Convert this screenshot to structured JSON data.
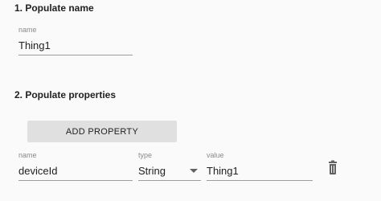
{
  "sections": {
    "name_title": "1. Populate name",
    "properties_title": "2. Populate properties"
  },
  "name_field": {
    "label": "name",
    "value": "Thing1"
  },
  "add_property": {
    "label": "ADD PROPERTY"
  },
  "property_row": {
    "name_label": "name",
    "name_value": "deviceId",
    "type_label": "type",
    "type_value": "String",
    "value_label": "value",
    "value_value": "Thing1"
  },
  "icons": {
    "delete": "trash-icon",
    "dropdown": "chevron-down-icon"
  },
  "colors": {
    "background": "#fafafa",
    "button": "#e0e0e0",
    "label": "#8a8a8a",
    "underline": "#9e9e9e",
    "icon": "#616161"
  }
}
